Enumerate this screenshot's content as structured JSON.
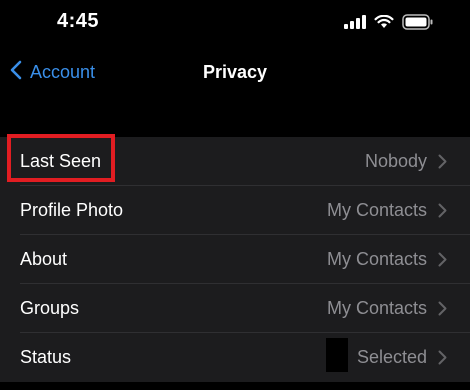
{
  "status_bar": {
    "time": "4:45",
    "icons": [
      "cellular-signal-icon",
      "wifi-icon",
      "battery-icon"
    ]
  },
  "nav": {
    "back_label": "Account",
    "back_icon": "chevron-left-icon",
    "title": "Privacy"
  },
  "colors": {
    "background": "#000000",
    "row_background": "#1c1c1e",
    "accent": "#3a8fe9",
    "secondary_text": "#8e8e93",
    "highlight": "#e11d22"
  },
  "privacy": {
    "rows": [
      {
        "label": "Last Seen",
        "value": "Nobody"
      },
      {
        "label": "Profile Photo",
        "value": "My Contacts"
      },
      {
        "label": "About",
        "value": "My Contacts"
      },
      {
        "label": "Groups",
        "value": "My Contacts"
      },
      {
        "label": "Status",
        "value": "Selected"
      }
    ]
  }
}
